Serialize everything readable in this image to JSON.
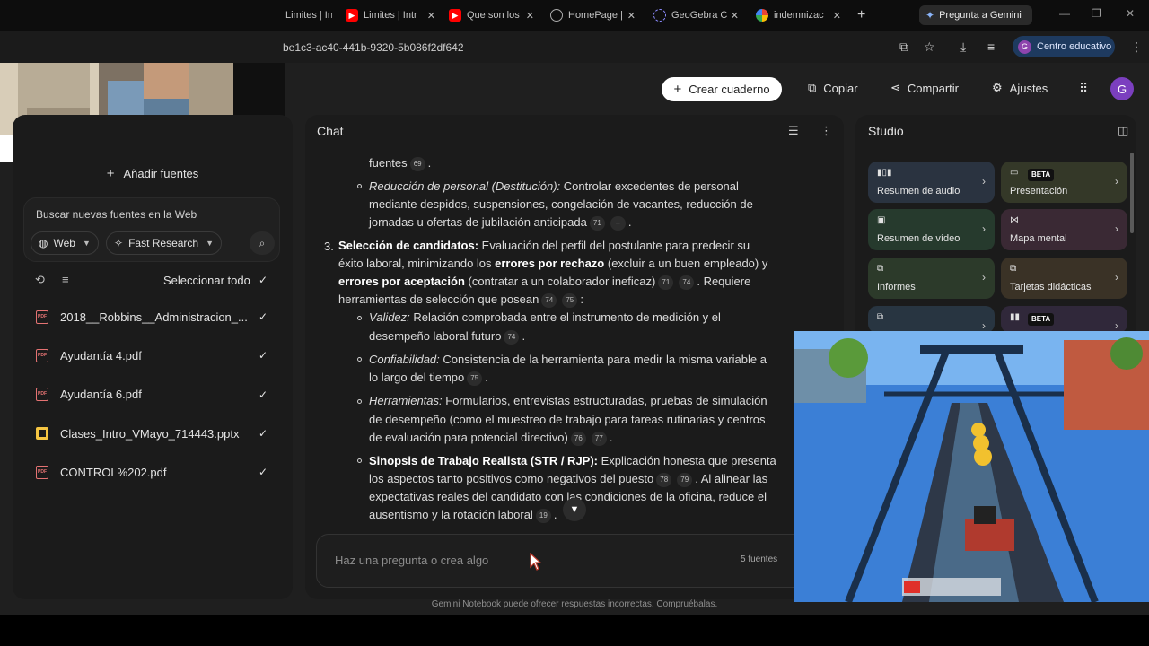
{
  "browser": {
    "tabs": [
      {
        "label": "Limites | Intr",
        "icon": "youtube-icon"
      },
      {
        "label": "Limites | Intr",
        "icon": "youtube-icon"
      },
      {
        "label": "Que son los",
        "icon": "youtube-icon"
      },
      {
        "label": "HomePage |",
        "icon": "globe-icon"
      },
      {
        "label": "GeoGebra C",
        "icon": "geogebra-icon"
      },
      {
        "label": "indemnizac",
        "icon": "google-icon"
      }
    ],
    "gemini_button": "Pregunta a Gemini",
    "url": "be1c3-ac40-441b-9320-5b086f2df642",
    "profile_label": "Centro educativo",
    "profile_initial": "G"
  },
  "header": {
    "create_notebook": "Crear cuaderno",
    "copy": "Copiar",
    "share": "Compartir",
    "settings": "Ajustes",
    "avatar_initial": "G"
  },
  "sources": {
    "add_label": "Añadir fuentes",
    "web_search_title": "Buscar nuevas fuentes en la Web",
    "web_chip": "Web",
    "research_chip": "Fast Research",
    "select_all": "Seleccionar todo",
    "items": [
      {
        "name": "2018__Robbins__Administracion_...",
        "type": "pdf",
        "checked": true
      },
      {
        "name": "Ayudantía 4.pdf",
        "type": "pdf",
        "checked": true
      },
      {
        "name": "Ayudantía 6.pdf",
        "type": "pdf",
        "checked": true
      },
      {
        "name": "Clases_Intro_VMayo_714443.pptx",
        "type": "pptx",
        "checked": true
      },
      {
        "name": "CONTROL%202.pdf",
        "type": "pdf",
        "checked": true
      }
    ]
  },
  "chat": {
    "title": "Chat",
    "input_placeholder": "Haz una pregunta o crea algo",
    "source_count": "5 fuentes",
    "disclaimer": "Gemini Notebook puede ofrecer respuestas incorrectas. Compruébalas.",
    "lines": {
      "l1": "fuentes",
      "l1_cite": "69",
      "l2_em": "Reducción de personal (Destitución):",
      "l2": " Controlar excedentes de personal",
      "l3": "mediante despidos, suspensiones, congelación de vacantes, reducción de",
      "l4": "jornadas u ofertas de jubilación anticipada",
      "l4_cite": "71",
      "l4_cite2": "–",
      "n3_num": "3.",
      "n3_b": "Selección de candidatos:",
      "n3": " Evaluación del perfil del postulante para predecir su",
      "l6a": "éxito laboral, minimizando los ",
      "l6b": "errores por rechazo",
      "l6c": " (excluir a un buen empleado) y",
      "l7b": "errores por aceptación",
      "l7c": " (contratar a un colaborador ineficaz)",
      "l7_cite": "71",
      "l7_cite2": "74",
      "l7d": ". Requiere",
      "l8": "herramientas de selección que posean",
      "l8_cite": "74",
      "l8_cite2": "75",
      "l8d": ":",
      "b1_em": "Validez:",
      "b1": " Relación comprobada entre el instrumento de medición y el",
      "b1b": "desempeño laboral futuro",
      "b1_cite": "74",
      "b2_em": "Confiabilidad:",
      "b2": " Consistencia de la herramienta para medir la misma variable a",
      "b2b": "lo largo del tiempo",
      "b2_cite": "75",
      "b3_em": "Herramientas:",
      "b3": " Formularios, entrevistas estructuradas, pruebas de simulación",
      "b3b": "de desempeño (como el muestreo de trabajo para tareas rutinarias y centros",
      "b3c": "de evaluación para potencial directivo)",
      "b3_cite": "76",
      "b3_cite2": "77",
      "b4_b": "Sinopsis de Trabajo Realista (STR / RJP):",
      "b4": " Explicación honesta que presenta",
      "b4b": "los aspectos tanto positivos como negativos del puesto",
      "b4_cite": "78",
      "b4_cite2": "79",
      "b4c": ". Al alinear las",
      "b4d": "expectativas reales del candidato con las condiciones de la oficina, reduce el",
      "b4e": "ausentismo y la rotación laboral",
      "b4_cite3": "19"
    }
  },
  "studio": {
    "title": "Studio",
    "beta_label": "BETA",
    "cards": [
      {
        "label": "Resumen de audio",
        "icon": "audio-waveform-icon"
      },
      {
        "label": "Presentación",
        "icon": "slides-icon",
        "beta": true
      },
      {
        "label": "Resumen de vídeo",
        "icon": "video-icon"
      },
      {
        "label": "Mapa mental",
        "icon": "mind-map-icon"
      },
      {
        "label": "Informes",
        "icon": "report-icon"
      },
      {
        "label": "Tarjetas didácticas",
        "icon": "flashcards-icon"
      }
    ]
  },
  "colors": {
    "audio_card": "#2a3340",
    "presentation_card": "#343828",
    "video_card": "#263a2d",
    "mindmap_card": "#3a2934",
    "report_card": "#2c3a2a",
    "flashcards_card": "#3a3226",
    "profile_pill": "#1e3a5f",
    "avatar": "#7b3fbf"
  }
}
